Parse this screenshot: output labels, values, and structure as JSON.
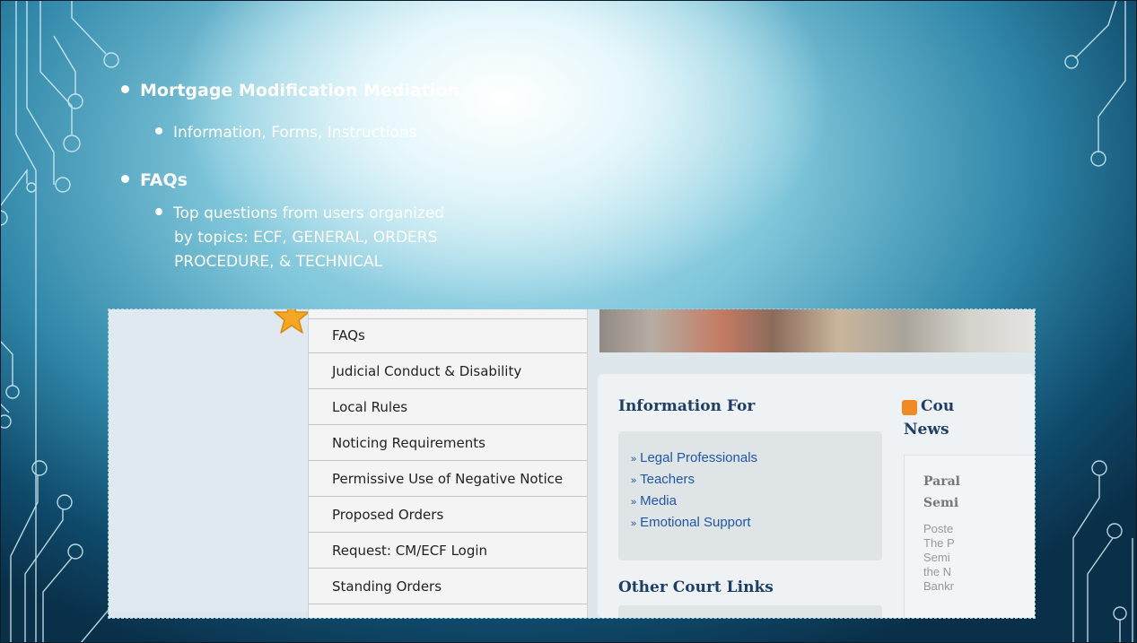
{
  "slide": {
    "bullets": [
      {
        "text": "Mortgage Modification Mediation",
        "sub": [
          "Information, Forms, Instructions"
        ]
      },
      {
        "text": "FAQs",
        "sub": [
          "Top questions from users organized",
          "by topics:  ECF, GENERAL, ORDERS",
          "PROCEDURE, & TECHNICAL"
        ]
      }
    ]
  },
  "screenshot": {
    "menu": [
      "FAQs",
      "Judicial Conduct & Disability",
      "Local Rules",
      "Noticing Requirements",
      "Permissive Use of Negative Notice",
      "Proposed Orders",
      "Request: CM/ECF Login",
      "Standing Orders"
    ],
    "info_heading": "Information For",
    "info_links": [
      "Legal Professionals",
      "Teachers",
      "Media",
      "Emotional Support"
    ],
    "other_heading": "Other Court Links",
    "news_heading_line1": "Cou",
    "news_heading_line2": "News",
    "news_item_title": [
      "Paral",
      "Semi"
    ],
    "news_item_body": [
      "Poste",
      "The P",
      "Semi",
      "the N",
      "Bankr"
    ]
  },
  "colors": {
    "heading": "#1f3e66",
    "link": "#1f56a6",
    "star": "#f5a623"
  }
}
